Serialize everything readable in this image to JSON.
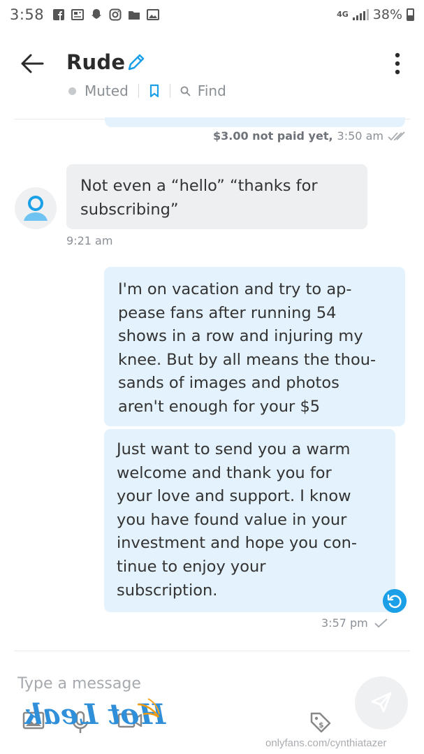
{
  "status_bar": {
    "time": "3:58",
    "network": "4G",
    "battery": "38%",
    "icons": [
      "facebook-icon",
      "news-icon",
      "snapchat-icon",
      "instagram-icon",
      "folder-icon",
      "gallery-icon"
    ]
  },
  "header": {
    "name": "Rude",
    "status": "Muted",
    "find_label": "Find",
    "icons": [
      "back-arrow-icon",
      "pencil-icon",
      "bookmark-icon",
      "search-icon",
      "more-vertical-icon"
    ]
  },
  "messages": [
    {
      "type": "outgoing",
      "price_status": "$3.00 not paid yet,",
      "time": "3:50 am"
    },
    {
      "type": "incoming",
      "lines": [
        "Not even a “hello” “thanks for",
        "subscribing”"
      ],
      "time": "9:21 am"
    },
    {
      "type": "outgoing",
      "lines": [
        "I'm on vacation and try to ap-",
        "pease fans after running 54",
        "shows in a row and injuring my",
        "knee. But by all means the thou-",
        "sands of images and photos",
        "aren't enough for your $5"
      ]
    },
    {
      "type": "outgoing",
      "lines": [
        "Just want to send you a warm",
        "welcome and thank you for",
        "your love and support. I know",
        "you have found value in your",
        "investment and hope you con-",
        "tinue to enjoy your",
        "subscription."
      ],
      "time": "3:57 pm"
    }
  ],
  "composer": {
    "placeholder": "Type a message",
    "icons": [
      "image-icon",
      "microphone-icon",
      "video-icon",
      "price-tag-icon",
      "send-icon"
    ]
  },
  "watermark": {
    "logo_text": "Hot Leak",
    "url": "onlyfans.com/cynthiatazer"
  },
  "colors": {
    "accent": "#1ba0e8",
    "outgoing_bubble": "#e3f2fc",
    "incoming_bubble": "#eeeff1",
    "muted_text": "#8a8f94"
  }
}
